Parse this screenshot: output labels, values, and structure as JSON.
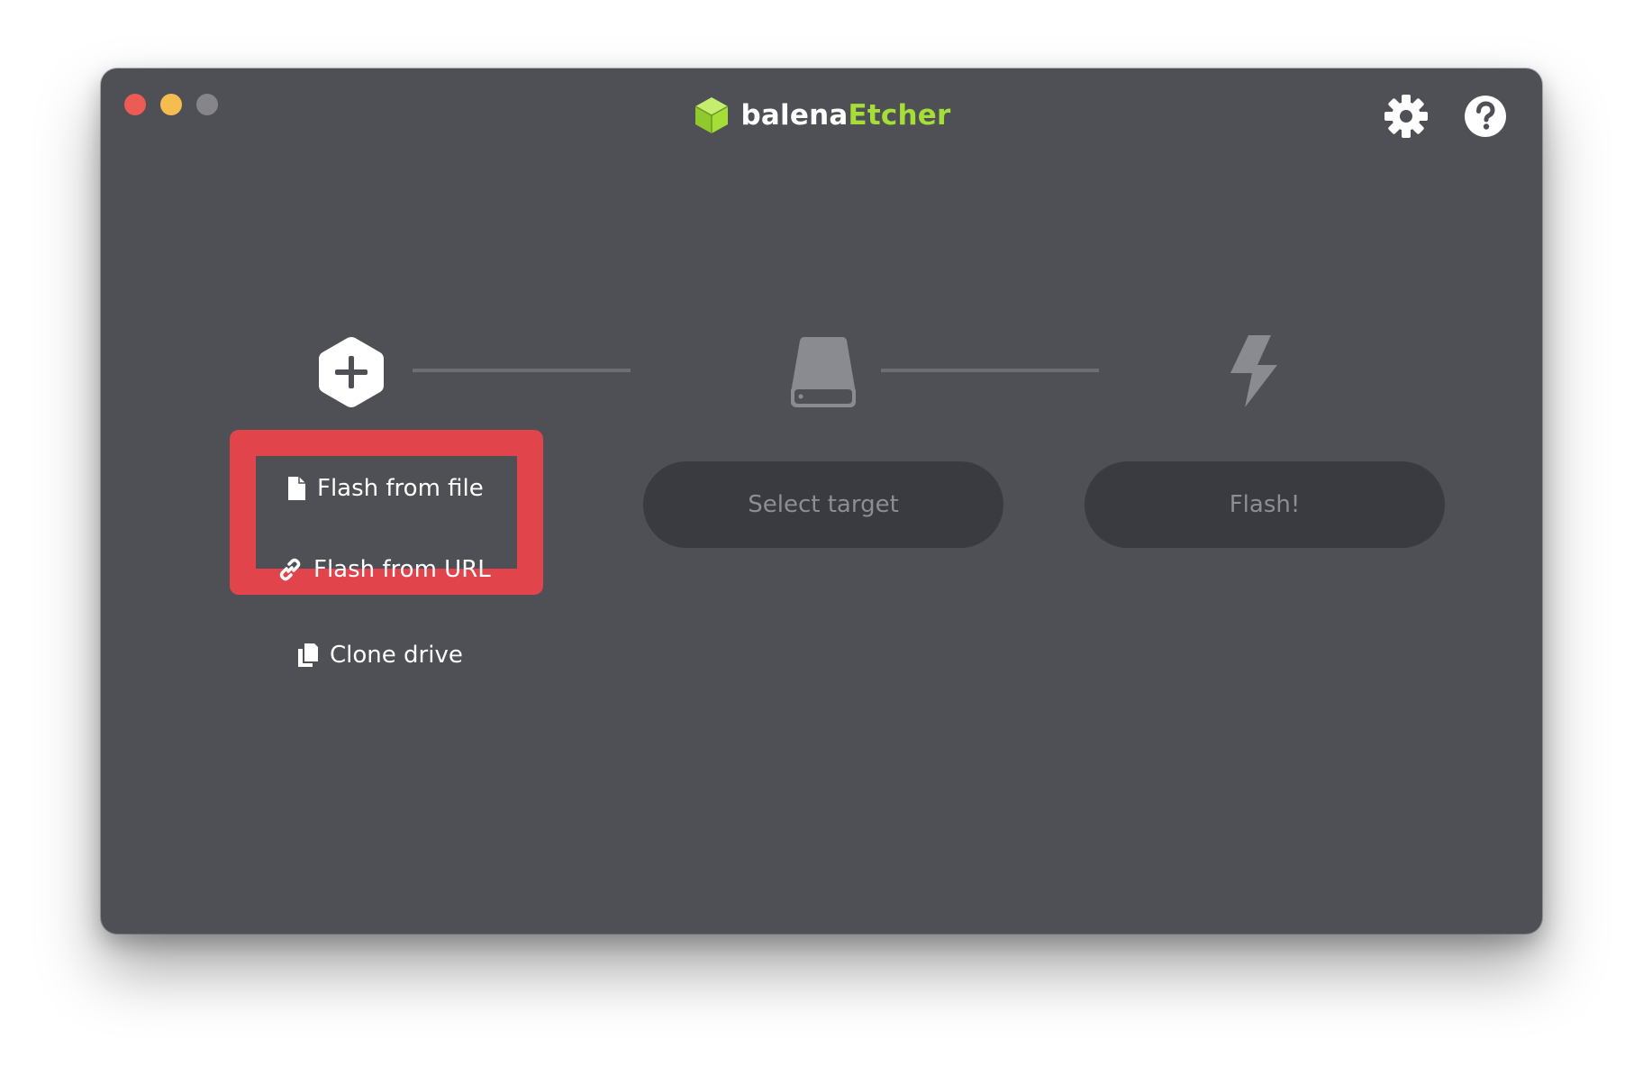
{
  "app": {
    "brand_name_part1": "balena",
    "brand_name_part2": "Etcher",
    "brand_accent_color": "#a5de37"
  },
  "window_controls": [
    "close",
    "minimize",
    "maximize"
  ],
  "header_icons": {
    "settings": "gear-icon",
    "help": "help-icon"
  },
  "steps": [
    {
      "icon": "plus-hexagon-icon"
    },
    {
      "icon": "drive-icon"
    },
    {
      "icon": "lightning-icon"
    }
  ],
  "actions": {
    "flash_from_file": "Flash from file",
    "flash_from_url": "Flash from URL",
    "clone_drive": "Clone drive"
  },
  "buttons": {
    "select_target": "Select target",
    "flash": "Flash!"
  },
  "colors": {
    "window_bg": "#4f5056",
    "button_bg": "#3a3b40",
    "highlight": "#e1444a"
  }
}
